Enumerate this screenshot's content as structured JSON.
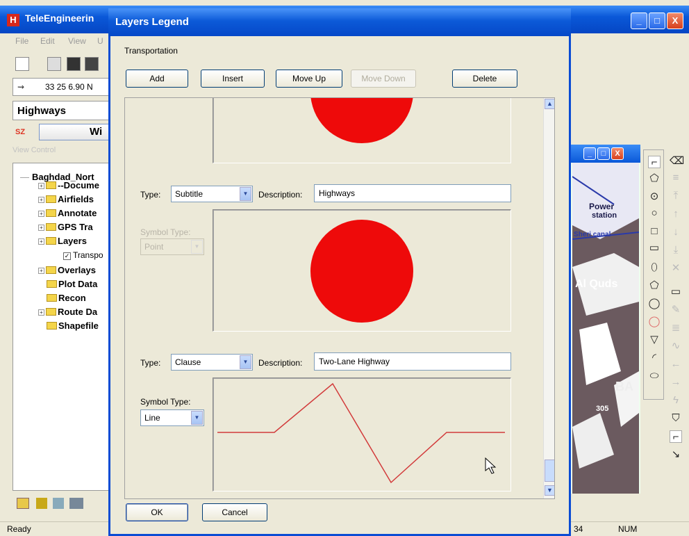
{
  "app": {
    "title": "TeleEngineerin",
    "logo_letter": "H",
    "menu": [
      "File",
      "Edit",
      "View",
      "U"
    ],
    "coord_value": "33 25  6.90 N",
    "layer_select": "Highways",
    "sz_label": "SZ",
    "wi_label": "Wi",
    "view_control": "View Control",
    "minimize": "_",
    "maximize": "□",
    "close": "X"
  },
  "tree": {
    "root": "Baghdad_Nort",
    "items": [
      {
        "label": "--Docume",
        "expandable": true
      },
      {
        "label": "Airfields",
        "expandable": true
      },
      {
        "label": "Annotate",
        "expandable": true
      },
      {
        "label": "GPS Tra",
        "expandable": true
      },
      {
        "label": "Layers",
        "expandable": true
      },
      {
        "label": "Transpo",
        "checkbox": true
      },
      {
        "label": "Overlays",
        "expandable": true
      },
      {
        "label": "Plot Data",
        "expandable": false
      },
      {
        "label": "Recon",
        "expandable": false
      },
      {
        "label": "Route Da",
        "expandable": true
      },
      {
        "label": "Shapefile",
        "expandable": false
      }
    ]
  },
  "status": {
    "left": "Ready",
    "coord": "34",
    "num": "NUM"
  },
  "map": {
    "labels": [
      "Power",
      "station",
      "Sheri canal",
      "Al Quds",
      "BA",
      "305"
    ]
  },
  "dialog": {
    "title": "Layers Legend",
    "layer_name": "Transportation",
    "buttons": {
      "add": "Add",
      "insert": "Insert",
      "move_up": "Move Up",
      "move_down": "Move Down",
      "delete": "Delete",
      "ok": "OK",
      "cancel": "Cancel"
    },
    "type_label": "Type:",
    "description_label": "Description:",
    "symbol_type_label": "Symbol Type:",
    "entries": [
      {
        "type": "Subtitle",
        "description": "Highways",
        "symbol_type": "Point",
        "symbol_enabled": false
      },
      {
        "type": "Clause",
        "description": "Two-Lane Highway",
        "symbol_type": "Line",
        "symbol_enabled": true
      }
    ],
    "colors": {
      "symbol": "#ee0a0a",
      "line": "#d23a3a"
    }
  }
}
